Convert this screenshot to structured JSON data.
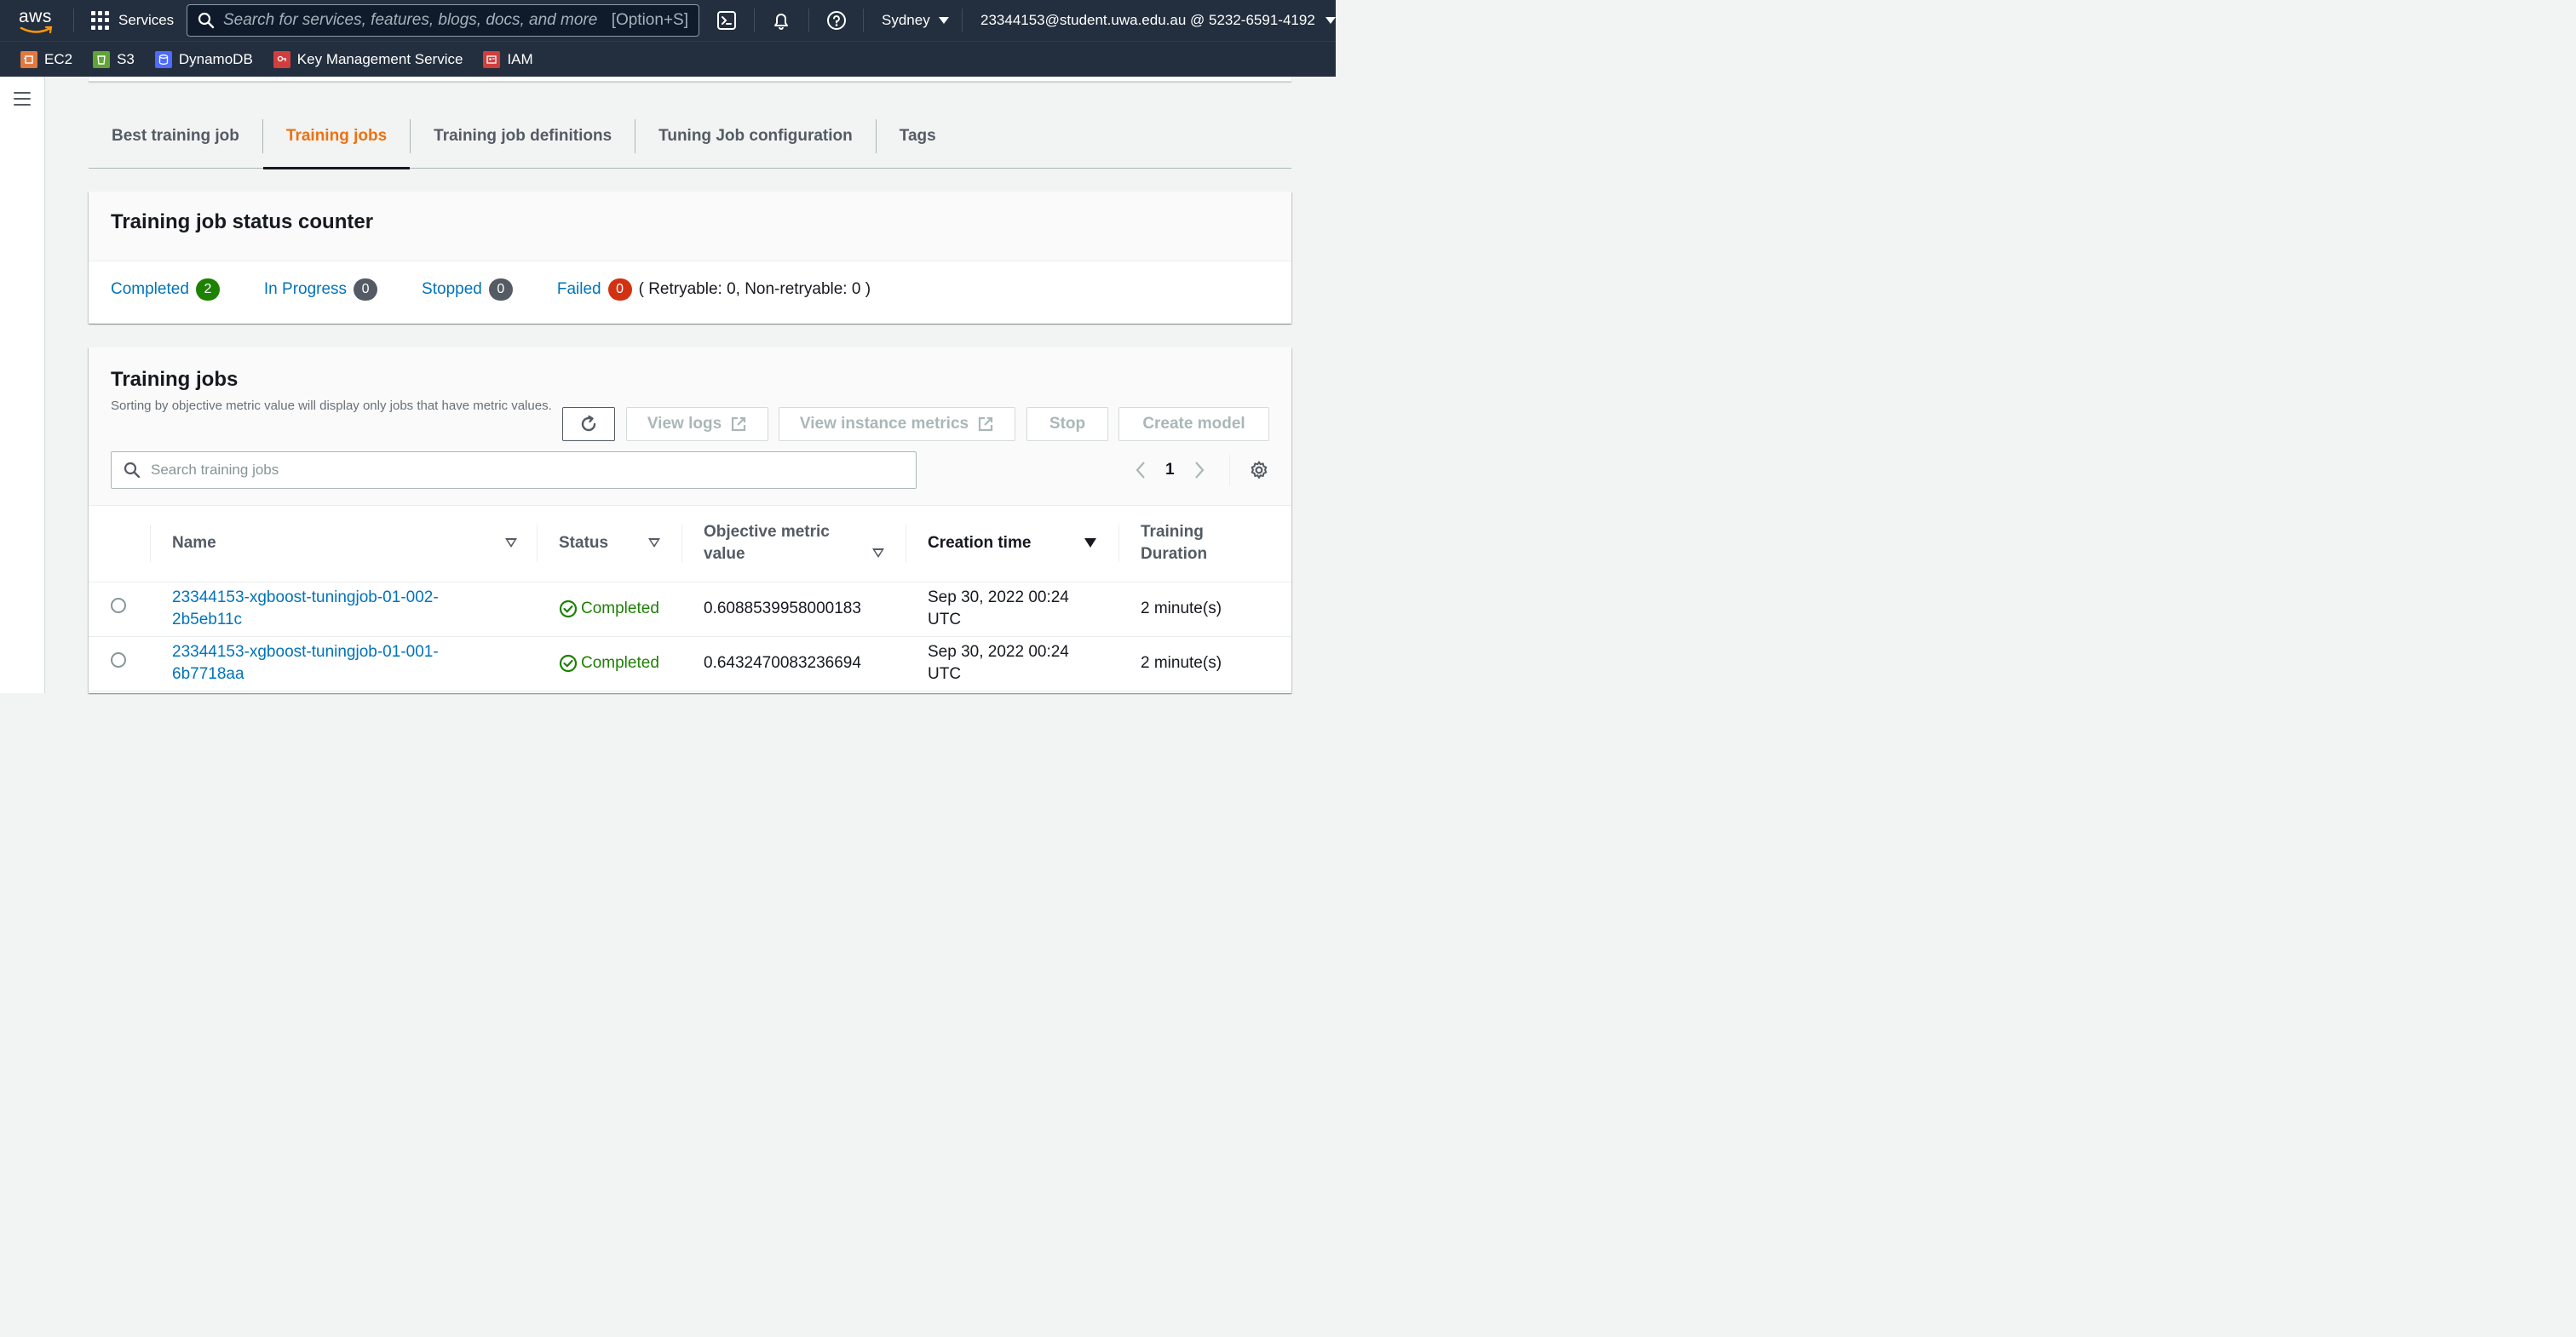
{
  "topnav": {
    "logo": "aws",
    "services_label": "Services",
    "search_placeholder": "Search for services, features, blogs, docs, and more",
    "search_shortcut": "[Option+S]",
    "region": "Sydney",
    "account": "23344153@student.uwa.edu.au @ 5232-6591-4192"
  },
  "favorites": [
    {
      "label": "EC2",
      "icon": "ec2-icon",
      "color": "#e07941"
    },
    {
      "label": "S3",
      "icon": "s3-icon",
      "color": "#60a337"
    },
    {
      "label": "DynamoDB",
      "icon": "dynamodb-icon",
      "color": "#4d6bfe"
    },
    {
      "label": "Key Management Service",
      "icon": "kms-icon",
      "color": "#d13e3e"
    },
    {
      "label": "IAM",
      "icon": "iam-icon",
      "color": "#d13e3e"
    }
  ],
  "tabs": [
    {
      "label": "Best training job",
      "active": false
    },
    {
      "label": "Training jobs",
      "active": true
    },
    {
      "label": "Training job definitions",
      "active": false
    },
    {
      "label": "Tuning Job configuration",
      "active": false
    },
    {
      "label": "Tags",
      "active": false
    }
  ],
  "counter": {
    "title": "Training job status counter",
    "items": [
      {
        "label": "Completed",
        "count": "2",
        "color": "#1d8102"
      },
      {
        "label": "In Progress",
        "count": "0",
        "color": "#545b64"
      },
      {
        "label": "Stopped",
        "count": "0",
        "color": "#545b64"
      },
      {
        "label": "Failed",
        "count": "0",
        "color": "#d13212"
      }
    ],
    "retry_note": "( Retryable: 0, Non-retryable: 0 )"
  },
  "jobs": {
    "title": "Training jobs",
    "description": "Sorting by objective metric value will display only jobs that have metric values.",
    "buttons": {
      "view_logs": "View logs",
      "view_instance_metrics": "View instance metrics",
      "stop": "Stop",
      "create_model": "Create model"
    },
    "search_placeholder": "Search training jobs",
    "page": "1",
    "columns": {
      "name": "Name",
      "status": "Status",
      "metric": "Objective metric value",
      "creation": "Creation time",
      "duration": "Training Duration"
    },
    "rows": [
      {
        "name": "23344153-xgboost-tuningjob-01-002-2b5eb11c",
        "status": "Completed",
        "metric": "0.6088539958000183",
        "creation": "Sep 30, 2022 00:24 UTC",
        "duration": "2 minute(s)"
      },
      {
        "name": "23344153-xgboost-tuningjob-01-001-6b7718aa",
        "status": "Completed",
        "metric": "0.6432470083236694",
        "creation": "Sep 30, 2022 00:24 UTC",
        "duration": "2 minute(s)"
      }
    ]
  }
}
